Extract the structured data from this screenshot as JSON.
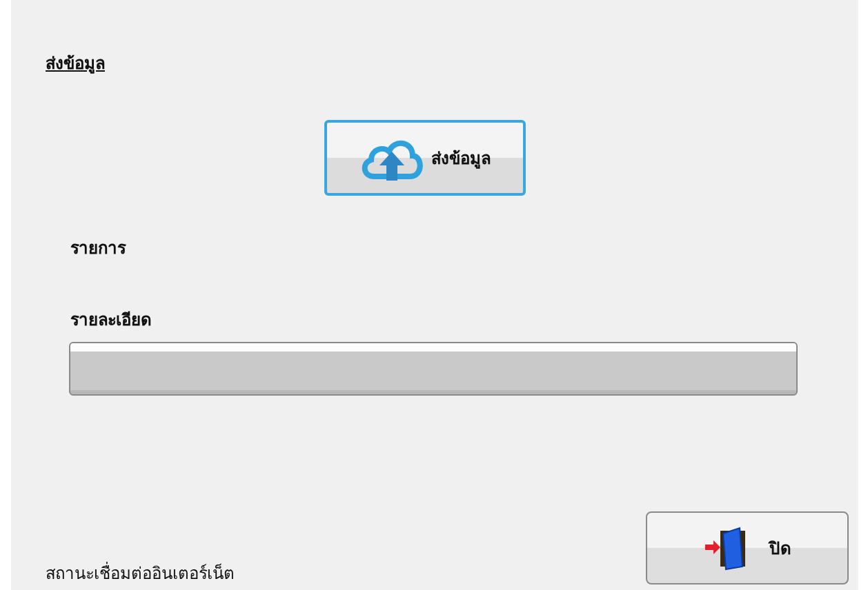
{
  "section_title": "ส่งข้อมูล",
  "send_button": {
    "label": "ส่งข้อมูล"
  },
  "item_label": "รายการ",
  "detail_label": "รายละเอียด",
  "progress": {
    "level": 0
  },
  "close_button": {
    "label": "ปิด"
  },
  "status_text": "สถานะเชื่อมต่ออินเตอร์เน็ต"
}
